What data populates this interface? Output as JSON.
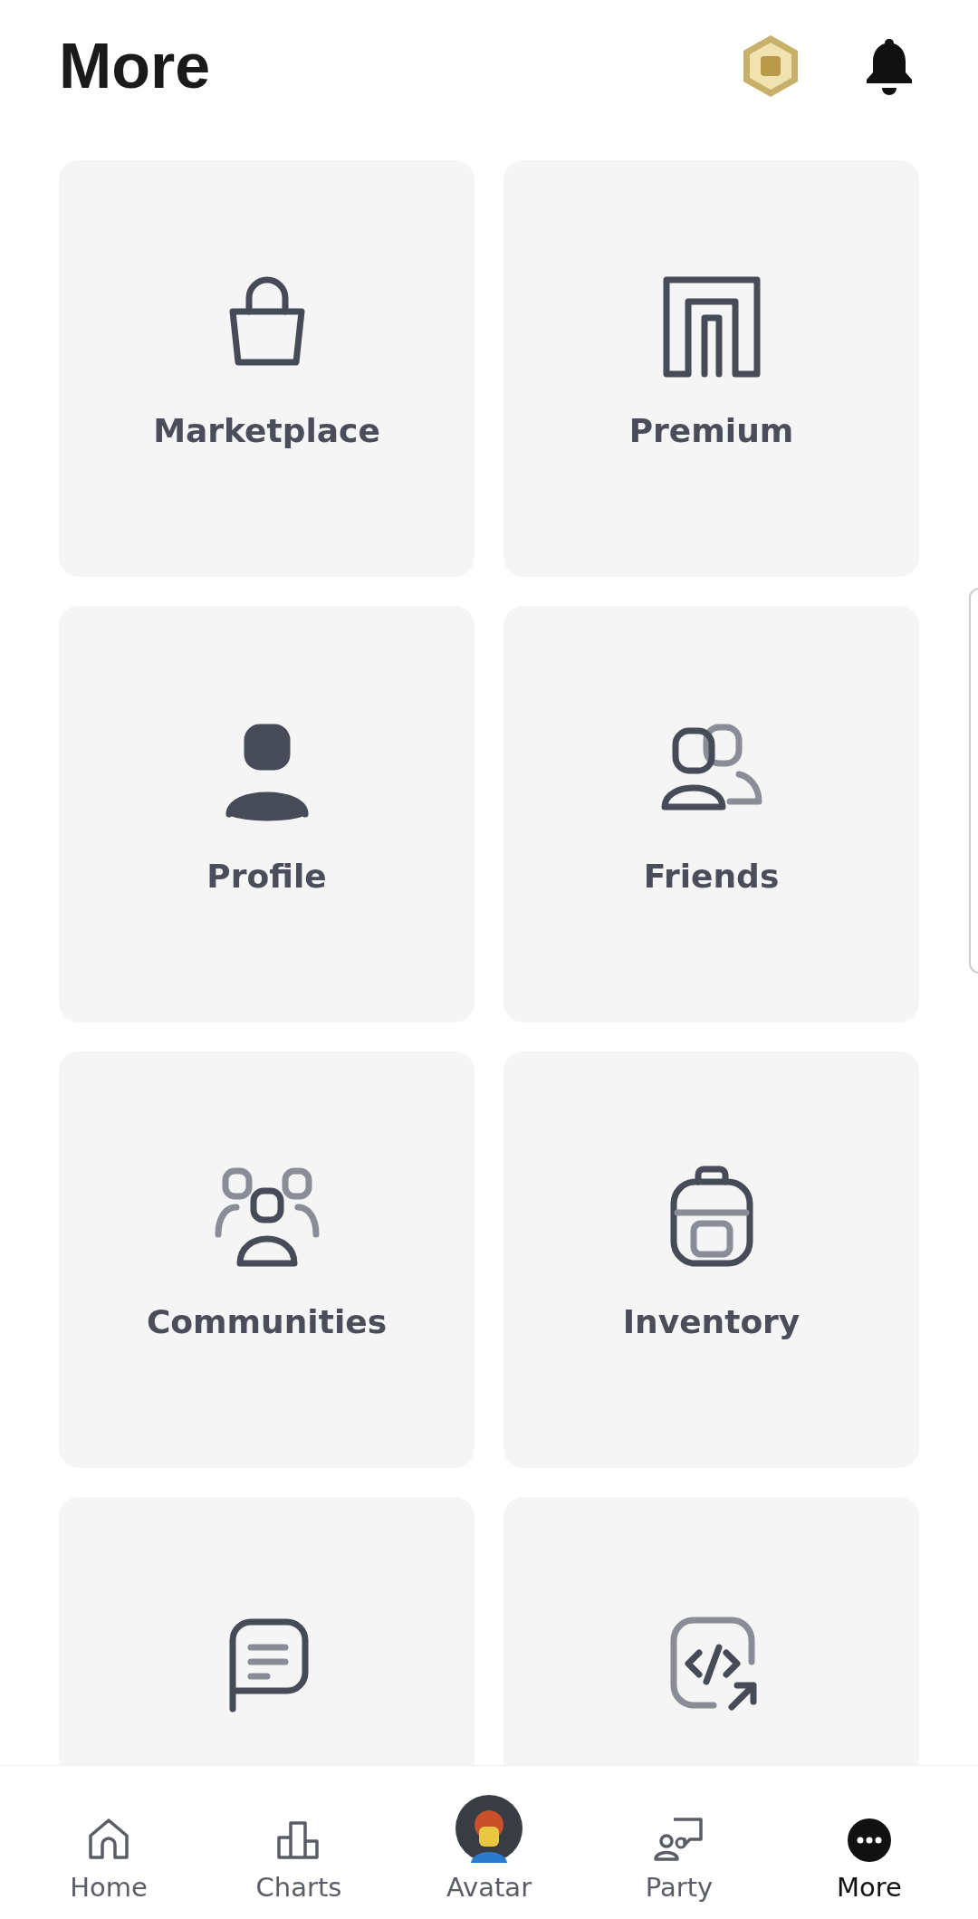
{
  "header": {
    "title": "More"
  },
  "tiles": [
    {
      "kind": "labeled",
      "label": "Marketplace"
    },
    {
      "kind": "labeled",
      "label": "Premium"
    },
    {
      "kind": "labeled",
      "label": "Profile"
    },
    {
      "kind": "labeled",
      "label": "Friends"
    },
    {
      "kind": "labeled",
      "label": "Communities"
    },
    {
      "kind": "labeled",
      "label": "Inventory"
    },
    {
      "kind": "icon-only"
    },
    {
      "kind": "icon-only"
    }
  ],
  "nav": [
    {
      "label": "Home",
      "selected": false
    },
    {
      "label": "Charts",
      "selected": false
    },
    {
      "label": "Avatar",
      "selected": false
    },
    {
      "label": "Party",
      "selected": false
    },
    {
      "label": "More",
      "selected": true
    }
  ]
}
